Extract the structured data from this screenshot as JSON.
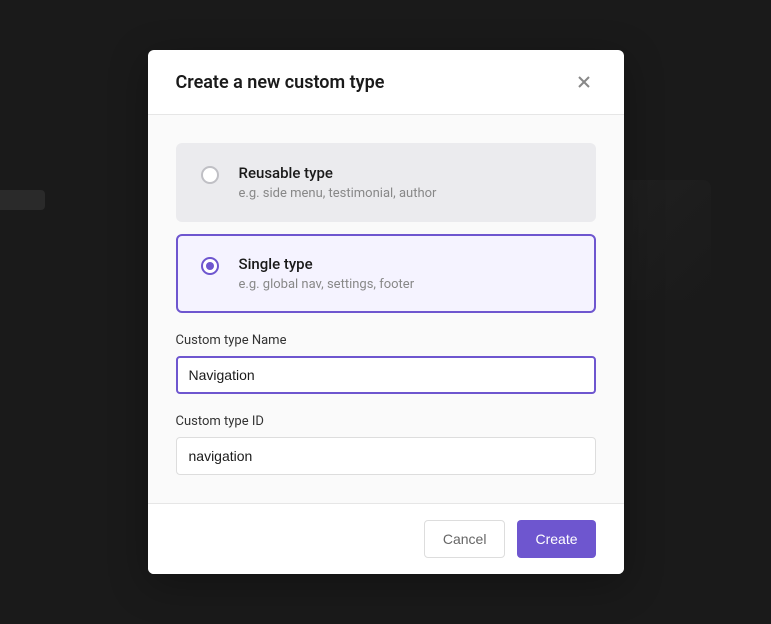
{
  "modal": {
    "title": "Create a new custom type",
    "typeOptions": [
      {
        "title": "Reusable type",
        "description": "e.g. side menu, testimonial, author",
        "selected": false
      },
      {
        "title": "Single type",
        "description": "e.g. global nav, settings, footer",
        "selected": true
      }
    ],
    "nameField": {
      "label": "Custom type Name",
      "value": "Navigation"
    },
    "idField": {
      "label": "Custom type ID",
      "value": "navigation"
    },
    "buttons": {
      "cancel": "Cancel",
      "create": "Create"
    }
  }
}
